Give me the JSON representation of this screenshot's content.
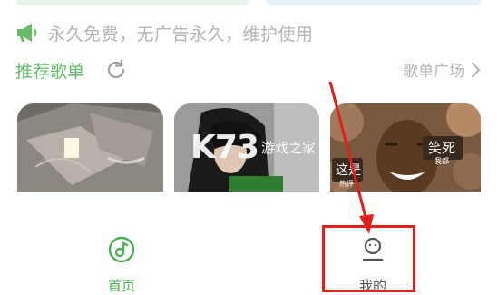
{
  "notice": {
    "text": "永久免费，无广告永久，维护使用",
    "icon": "megaphone-icon"
  },
  "recommend": {
    "title": "推荐歌单",
    "refresh_icon": "refresh-icon",
    "more_label": "歌单广场"
  },
  "playlists": [
    {
      "name": "playlist-card-1"
    },
    {
      "name": "playlist-card-2"
    },
    {
      "name": "playlist-card-3",
      "overlay_texts": [
        "笑死",
        "我都",
        "这是",
        "热评"
      ]
    }
  ],
  "watermark": {
    "brand": "K73",
    "site": "游戏之家"
  },
  "tabbar": {
    "home": {
      "label": "首页",
      "icon": "music-disc-icon"
    },
    "mine": {
      "label": "我的",
      "icon": "user-icon"
    }
  },
  "annotation": {
    "color": "#e0201b"
  },
  "colors": {
    "accent": "#4caf50",
    "muted": "#b3b3b3"
  }
}
